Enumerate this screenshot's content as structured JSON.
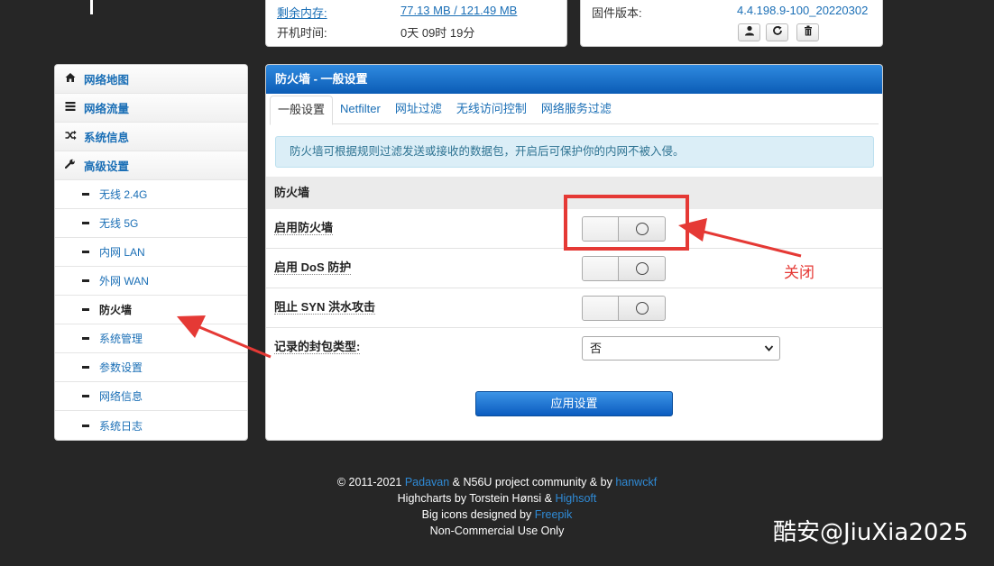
{
  "top_left": {
    "memory_label": "剩余内存:",
    "memory_value": "77.13 MB / 121.49 MB",
    "uptime_label": "开机时间:",
    "uptime_value": "0天 09时 19分"
  },
  "top_right": {
    "firmware_label": "固件版本:",
    "firmware_value": "4.4.198.9-100_20220302",
    "buttons": [
      "user-icon",
      "refresh-icon",
      "trash-icon"
    ]
  },
  "sidebar": {
    "items": [
      {
        "label": "网络地图",
        "icon": "home-icon"
      },
      {
        "label": "网络流量",
        "icon": "list-icon"
      },
      {
        "label": "系统信息",
        "icon": "shuffle-icon"
      },
      {
        "label": "高级设置",
        "icon": "wrench-icon"
      }
    ],
    "subitems": [
      "无线 2.4G",
      "无线 5G",
      "内网 LAN",
      "外网 WAN",
      "防火墙",
      "系统管理",
      "参数设置",
      "网络信息",
      "系统日志"
    ],
    "active_subitem": "防火墙"
  },
  "panel": {
    "title": "防火墙 - 一般设置",
    "tabs": [
      "一般设置",
      "Netfilter",
      "网址过滤",
      "无线访问控制",
      "网络服务过滤"
    ],
    "active_tab": "一般设置",
    "info": "防火墙可根据规则过滤发送或接收的数据包，开启后可保护你的内网不被入侵。",
    "section": "防火墙",
    "settings": [
      {
        "label": "启用防火墙",
        "state": "off"
      },
      {
        "label": "启用 DoS 防护",
        "state": "off"
      },
      {
        "label": "阻止 SYN 洪水攻击",
        "state": "off"
      }
    ],
    "log_label": "记录的封包类型:",
    "log_value": "否",
    "apply_label": "应用设置"
  },
  "annotation": {
    "text": "关闭",
    "color": "#e53935"
  },
  "footer": {
    "line1_a": "© 2011-2021 ",
    "line1_link1": "Padavan",
    "line1_b": " & N56U project community & by ",
    "line1_link2": "hanwckf",
    "line2_a": "Highcharts by Torstein Hønsi & ",
    "line2_link": "Highsoft",
    "line3_a": "Big icons designed by ",
    "line3_link": "Freepik",
    "line4": "Non-Commercial Use Only"
  },
  "watermark": "酷安@JiuXia2025"
}
